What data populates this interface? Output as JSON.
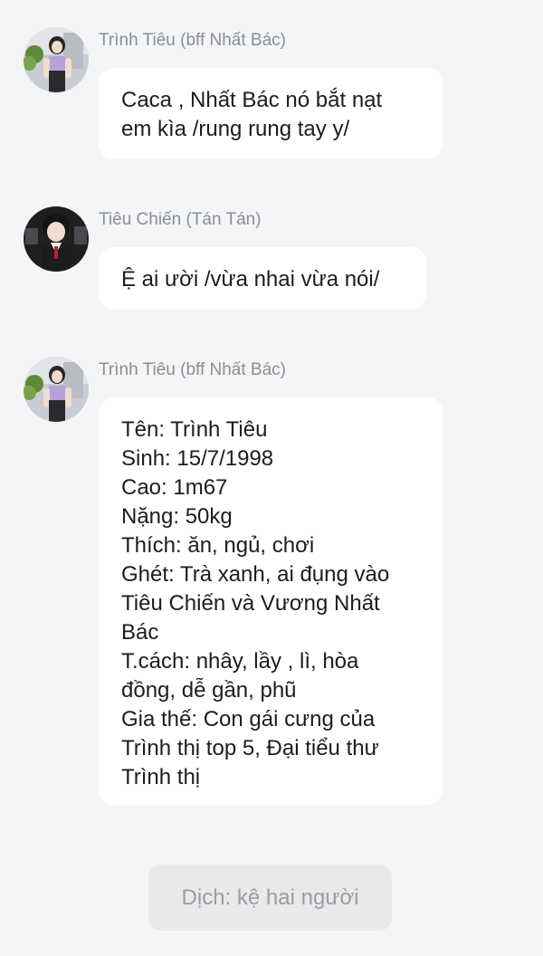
{
  "messages": [
    {
      "sender": "Trình Tiêu (bff Nhất Bác)",
      "lines": [
        "Caca , Nhất Bác nó bắt nạt",
        "em kìa /rung rung tay y/"
      ]
    },
    {
      "sender": "Tiêu Chiến (Tán Tán)",
      "lines": [
        "Ệ ai ười /vừa nhai vừa nói/"
      ]
    },
    {
      "sender": "Trình Tiêu (bff Nhất Bác)",
      "lines": [
        "Tên: Trình Tiêu",
        "Sinh: 15/7/1998",
        "Cao: 1m67",
        "Nặng: 50kg",
        "Thích: ăn, ngủ, chơi",
        "Ghét: Trà xanh, ai đụng vào",
        "Tiêu Chiến và Vương Nhất",
        "Bác",
        "T.cách: nhây, lầy , lì, hòa",
        "đồng, dễ gần, phũ",
        "Gia thế: Con gái cưng của",
        "Trình thị top 5, Đại tiểu thư",
        "Trình thị"
      ]
    }
  ],
  "system_message": "Dịch: kệ hai người",
  "colors": {
    "background": "#f4f5f7",
    "bubble": "#ffffff",
    "sender_text": "#8a8d92",
    "message_text": "#1d1d1f",
    "system_bg": "#e8e9eb",
    "system_text": "#9a9ca0"
  }
}
